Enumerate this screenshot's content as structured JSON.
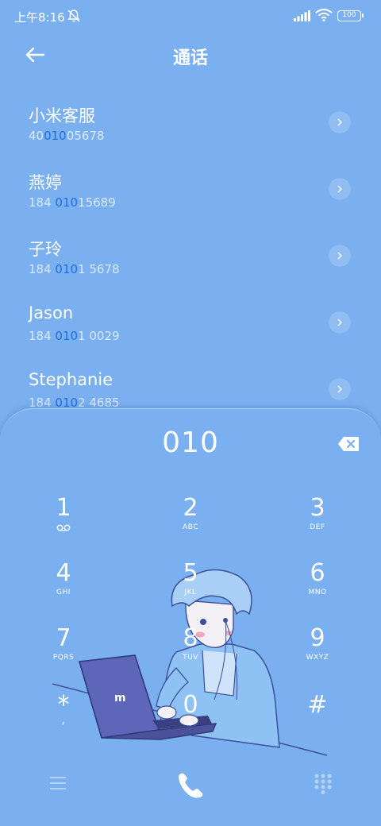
{
  "status_bar": {
    "time": "上午8:16",
    "battery": "100"
  },
  "header": {
    "title": "通话"
  },
  "contacts": [
    {
      "name": "小米客服",
      "number_pre": "40",
      "number_match": "010",
      "number_post": "05678"
    },
    {
      "name": "燕婷",
      "number_pre": "184 ",
      "number_match": "010",
      "number_post": "15689"
    },
    {
      "name": "子玲",
      "number_pre": "184 ",
      "number_match": "010",
      "number_post": "1 5678"
    },
    {
      "name": "Jason",
      "number_pre": "184 ",
      "number_match": "010",
      "number_post": "1 0029"
    },
    {
      "name": "Stephanie",
      "number_pre": "184 ",
      "number_match": "010",
      "number_post": "2 4685"
    }
  ],
  "dialer": {
    "input": "010",
    "keys": [
      {
        "digit": "1",
        "letters": ""
      },
      {
        "digit": "2",
        "letters": "ABC"
      },
      {
        "digit": "3",
        "letters": "DEF"
      },
      {
        "digit": "4",
        "letters": "GHI"
      },
      {
        "digit": "5",
        "letters": "JKL"
      },
      {
        "digit": "6",
        "letters": "MNO"
      },
      {
        "digit": "7",
        "letters": "PQRS"
      },
      {
        "digit": "8",
        "letters": "TUV"
      },
      {
        "digit": "9",
        "letters": "WXYZ"
      },
      {
        "digit": "*",
        "letters": ","
      },
      {
        "digit": "0",
        "letters": "+"
      },
      {
        "digit": "#",
        "letters": ""
      }
    ]
  },
  "icons": {
    "back": "arrow-left-icon",
    "mute": "notifications-off-icon",
    "signal": "cell-signal-icon",
    "wifi": "wifi-icon",
    "detail": "chevron-right-icon",
    "backspace": "backspace-icon",
    "menu": "menu-icon",
    "call": "phone-icon",
    "keypad": "dialpad-icon"
  },
  "colors": {
    "background": "#7bb0f0",
    "match_highlight": "#1c6fe3",
    "text": "#ffffff"
  }
}
